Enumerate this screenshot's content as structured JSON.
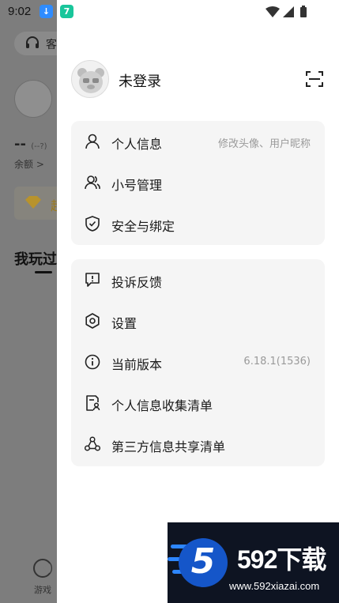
{
  "status_bar": {
    "time": "9:02",
    "notif_download": "↓",
    "notif_app": "7"
  },
  "background_page": {
    "service_label": "客",
    "stat_value": "--",
    "stat_hint": "(--?)",
    "balance_label": "余额 >",
    "banner_text": "超",
    "section_title": "我玩过",
    "nav_games_label": "游戏"
  },
  "drawer": {
    "login_text": "未登录",
    "groups": [
      {
        "items": [
          {
            "label": "个人信息",
            "hint": "修改头像、用户昵称",
            "icon": "person-icon"
          },
          {
            "label": "小号管理",
            "hint": "",
            "icon": "accounts-icon"
          },
          {
            "label": "安全与绑定",
            "hint": "",
            "icon": "shield-icon"
          }
        ]
      },
      {
        "items": [
          {
            "label": "投诉反馈",
            "hint": "",
            "icon": "feedback-icon"
          },
          {
            "label": "设置",
            "hint": "",
            "icon": "gear-icon"
          },
          {
            "label": "当前版本",
            "hint": "6.18.1(1536)",
            "icon": "info-icon"
          },
          {
            "label": "个人信息收集清单",
            "hint": "",
            "icon": "document-person-icon"
          },
          {
            "label": "第三方信息共享清单",
            "hint": "",
            "icon": "share-icon"
          }
        ]
      }
    ]
  },
  "watermark": {
    "logo_digit": "5",
    "title": "592下载",
    "url": "www.592xiazai.com"
  },
  "colors": {
    "card_bg": "#f5f5f5",
    "overlay": "#7a7a7a",
    "watermark_bg": "#0e1422",
    "watermark_accent": "#2d86ff"
  }
}
